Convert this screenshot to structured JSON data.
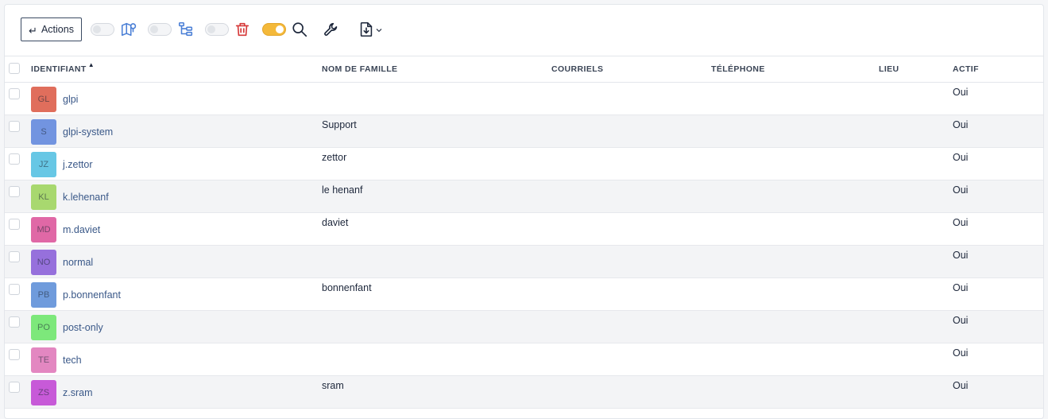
{
  "toolbar": {
    "actions_label": "Actions",
    "actions_icon": "corner-down-left-arrow",
    "toggles": [
      {
        "name": "map-toggle",
        "on": false,
        "icon": "map-marker-icon"
      },
      {
        "name": "tree-toggle",
        "on": false,
        "icon": "tree-icon"
      },
      {
        "name": "trash-toggle",
        "on": false,
        "icon": "trash-icon"
      },
      {
        "name": "search-toggle",
        "on": true,
        "icon": "search-icon"
      }
    ],
    "tools_icon": "wrench-icon",
    "export_icon": "file-download-icon"
  },
  "colors": {
    "accent": "#4a7fd6",
    "danger": "#d63939",
    "toggle_on": "#f4b93a",
    "link": "#3a5888",
    "row_alt": "#f3f4f6"
  },
  "table": {
    "columns": [
      "IDENTIFIANT",
      "NOM DE FAMILLE",
      "COURRIELS",
      "TÉLÉPHONE",
      "LIEU",
      "ACTIF"
    ],
    "sort_column": "IDENTIFIANT",
    "sort_direction": "ascending",
    "rows": [
      {
        "initials": "GL",
        "avatar_color": "#e06e5c",
        "login": "glpi",
        "lastname": "",
        "emails": "",
        "phone": "",
        "location": "",
        "active": "Oui"
      },
      {
        "initials": "S",
        "avatar_color": "#7294e0",
        "login": "glpi-system",
        "lastname": "Support",
        "emails": "",
        "phone": "",
        "location": "",
        "active": "Oui"
      },
      {
        "initials": "JZ",
        "avatar_color": "#67c7e5",
        "login": "j.zettor",
        "lastname": "zettor",
        "emails": "",
        "phone": "",
        "location": "",
        "active": "Oui"
      },
      {
        "initials": "KL",
        "avatar_color": "#a8d86f",
        "login": "k.lehenanf",
        "lastname": "le henanf",
        "emails": "",
        "phone": "",
        "location": "",
        "active": "Oui"
      },
      {
        "initials": "MD",
        "avatar_color": "#e068a6",
        "login": "m.daviet",
        "lastname": "daviet",
        "emails": "",
        "phone": "",
        "location": "",
        "active": "Oui"
      },
      {
        "initials": "NO",
        "avatar_color": "#9670dc",
        "login": "normal",
        "lastname": "",
        "emails": "",
        "phone": "",
        "location": "",
        "active": "Oui"
      },
      {
        "initials": "PB",
        "avatar_color": "#6f9bdc",
        "login": "p.bonnenfant",
        "lastname": "bonnenfant",
        "emails": "",
        "phone": "",
        "location": "",
        "active": "Oui"
      },
      {
        "initials": "PO",
        "avatar_color": "#7de87b",
        "login": "post-only",
        "lastname": "",
        "emails": "",
        "phone": "",
        "location": "",
        "active": "Oui"
      },
      {
        "initials": "TE",
        "avatar_color": "#e387c1",
        "login": "tech",
        "lastname": "",
        "emails": "",
        "phone": "",
        "location": "",
        "active": "Oui"
      },
      {
        "initials": "ZS",
        "avatar_color": "#c75ad8",
        "login": "z.sram",
        "lastname": "sram",
        "emails": "",
        "phone": "",
        "location": "",
        "active": "Oui"
      }
    ]
  }
}
